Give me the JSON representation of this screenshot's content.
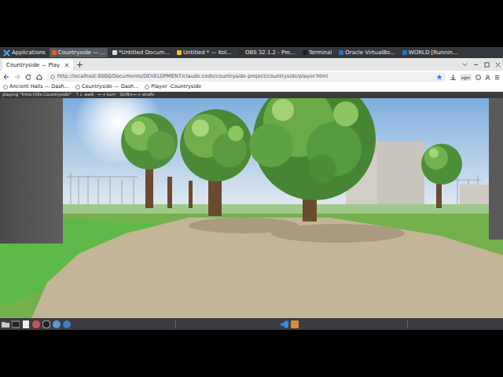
{
  "taskbar": {
    "menu": "Applications",
    "windows": [
      {
        "title": "Countryside — ...",
        "selected": true,
        "color": "#e06030"
      },
      {
        "title": "*Untitled Docum...",
        "selected": false,
        "color": "#dddddd"
      },
      {
        "title": "Untitled * — Kol...",
        "selected": false,
        "color": "#f0c040"
      },
      {
        "title": "OBS 32.1.2 - Pro...",
        "selected": false,
        "color": "#303030"
      },
      {
        "title": "Terminal",
        "selected": false,
        "color": "#202020"
      },
      {
        "title": "Oracle VirtualBo...",
        "selected": false,
        "color": "#3070c0"
      },
      {
        "title": "WORLD [Runnin...",
        "selected": false,
        "color": "#3070c0"
      }
    ]
  },
  "browser": {
    "tabs": [
      {
        "label": "Countryside — Play",
        "selected": true
      }
    ],
    "url": "http://localhost:8000/Documents/DEVELOPMENT/claude.code/countryside-project/countryside/player.html",
    "badge": "vpn",
    "bookmarks": [
      "Ancient Halls — Dash...",
      "Countryside — Dash...",
      "Player -Countryside"
    ]
  },
  "game": {
    "hud": "playing \"Intro.Hills.Countryside\" · ↑↓ walk · ←→ turn · Shift+←→ strafe"
  }
}
